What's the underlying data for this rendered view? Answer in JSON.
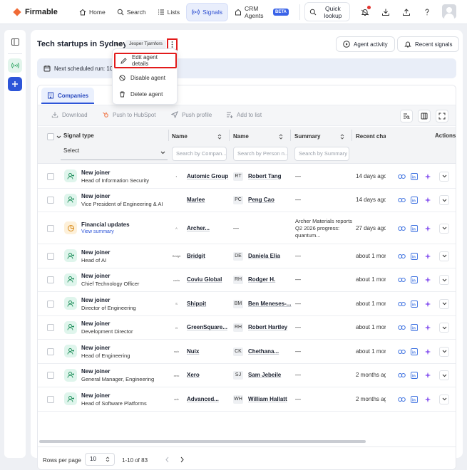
{
  "nav": {
    "brand": "Firmable",
    "items": [
      {
        "label": "Home",
        "icon": "home-icon"
      },
      {
        "label": "Search",
        "icon": "search-icon"
      },
      {
        "label": "Lists",
        "icon": "list-icon"
      },
      {
        "label": "Signals",
        "icon": "signal-icon",
        "active": true
      },
      {
        "label": "CRM Agents",
        "icon": "crm-icon",
        "badge": "BETA"
      }
    ],
    "quick_lookup": "Quick lookup"
  },
  "header": {
    "title": "Tech startups in Sydney",
    "owner": "Jesper Tjarnfors",
    "agent_activity": "Agent activity",
    "recent_signals": "Recent signals"
  },
  "banner": {
    "text": "Next scheduled run: 10"
  },
  "menu": {
    "items": [
      {
        "label": "Edit agent details",
        "icon": "pencil-icon"
      },
      {
        "label": "Disable agent",
        "icon": "disable-icon"
      },
      {
        "label": "Delete agent",
        "icon": "trash-icon"
      }
    ]
  },
  "tabs": {
    "companies": "Companies"
  },
  "toolbar": {
    "download": "Download",
    "push_hubspot": "Push to HubSpot",
    "push_profile": "Push profile",
    "add_to_list": "Add to list"
  },
  "table": {
    "headers": {
      "signal_type": "Signal type",
      "company_name": "Name",
      "person_name": "Name",
      "summary": "Summary",
      "recent": "Recent char",
      "actions": "Actions"
    },
    "filters": {
      "select": "Select",
      "company": "Search by Compan...",
      "person": "Search by Person n...",
      "summary": "Search by Summary"
    },
    "rows": [
      {
        "type": "New joiner",
        "sub": "Head of Information Security",
        "logo": "▪",
        "company": "Automic Group",
        "initials": "RT",
        "person": "Robert Tang",
        "summary": "—",
        "recent": "14 days ago"
      },
      {
        "type": "New joiner",
        "sub": "Vice President of Engineering & AI",
        "logo": "",
        "company": "Marlee",
        "initials": "PC",
        "person": "Peng Cao",
        "summary": "—",
        "recent": "14 days ago"
      },
      {
        "type": "Financial updates",
        "sub": "View summary",
        "logo": "Λ",
        "company": "Archer...",
        "initials": "",
        "person": "—",
        "summary": "Archer Materials reports Q2 2026 progress: quantum...",
        "recent": "27 days ago",
        "financial": true
      },
      {
        "type": "New joiner",
        "sub": "Head of AI",
        "logo": "Bridgit",
        "company": "Bridgit",
        "initials": "DE",
        "person": "Daniela Elia",
        "summary": "—",
        "recent": "about 1 mor"
      },
      {
        "type": "New joiner",
        "sub": "Chief Technology Officer",
        "logo": "coviu",
        "company": "Coviu Global",
        "initials": "RH",
        "person": "Rodger H.",
        "summary": "—",
        "recent": "about 1 mor"
      },
      {
        "type": "New joiner",
        "sub": "Director of Engineering",
        "logo": "S",
        "company": "Shippit",
        "initials": "BM",
        "person": "Ben Meneses-...",
        "summary": "—",
        "recent": "about 1 mor"
      },
      {
        "type": "New joiner",
        "sub": "Development Director",
        "logo": "G",
        "company": "GreenSquare...",
        "initials": "RH",
        "person": "Robert Hartley",
        "summary": "—",
        "recent": "about 1 mor"
      },
      {
        "type": "New joiner",
        "sub": "Head of Engineering",
        "logo": "nuix",
        "company": "Nuix",
        "initials": "CK",
        "person": "Chethana...",
        "summary": "—",
        "recent": "about 1 mor"
      },
      {
        "type": "New joiner",
        "sub": "General Manager, Engineering",
        "logo": "xero",
        "company": "Xero",
        "initials": "SJ",
        "person": "Sam Jebeile",
        "summary": "—",
        "recent": "2 months ag"
      },
      {
        "type": "New joiner",
        "sub": "Head of Software Platforms",
        "logo": "adv",
        "company": "Advanced...",
        "initials": "WH",
        "person": "William Hallatt",
        "summary": "—",
        "recent": "2 months ag"
      }
    ]
  },
  "footer": {
    "rows_per_page": "Rows per page",
    "page_size": "10",
    "range": "1-10 of 83"
  }
}
